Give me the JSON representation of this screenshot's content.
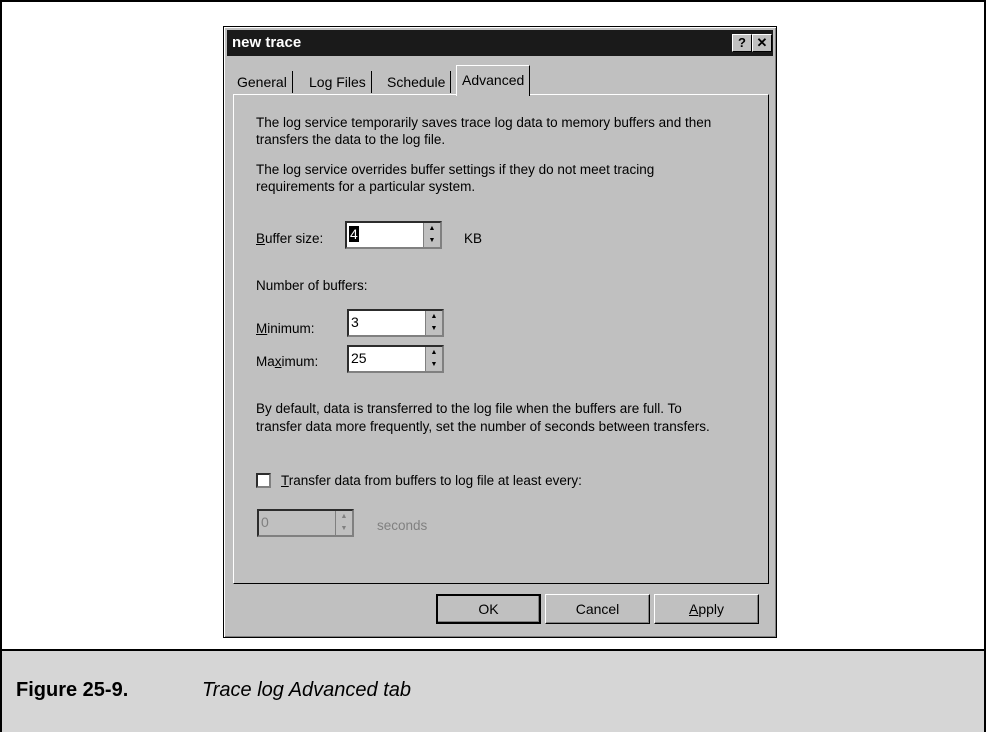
{
  "dialog": {
    "title": "new trace",
    "help_icon": "?",
    "close_icon": "✕"
  },
  "tabs": [
    {
      "label": "General"
    },
    {
      "label": "Log Files"
    },
    {
      "label": "Schedule"
    },
    {
      "label": "Advanced",
      "active": true
    }
  ],
  "advanced": {
    "intro1_line1": "The log service temporarily saves trace log data to memory buffers and then",
    "intro1_line2": "transfers the data to the log file.",
    "intro2_line1": "The log service overrides buffer settings if they do not meet tracing",
    "intro2_line2": "requirements for a particular system.",
    "buffer_size_label_mnemonic": "B",
    "buffer_size_label_rest": "uffer size:",
    "buffer_size_value": "4",
    "buffer_size_unit": "KB",
    "num_buffers_label": "Number of buffers:",
    "minimum_label_mnemonic": "M",
    "minimum_label_rest": "inimum:",
    "minimum_value": "3",
    "maximum_label_pre": "Ma",
    "maximum_label_mnemonic": "x",
    "maximum_label_rest": "imum:",
    "maximum_value": "25",
    "default_note_line1": "By default, data is transferred to the log file when the buffers are full. To",
    "default_note_line2": "transfer data more frequently, set the number of seconds between transfers.",
    "transfer_checkbox_mnemonic": "T",
    "transfer_checkbox_rest": "ransfer data from buffers to log file at least every:",
    "transfer_checked": false,
    "seconds_value": "0",
    "seconds_unit": "seconds"
  },
  "buttons": {
    "ok": "OK",
    "cancel": "Cancel",
    "apply_mnemonic": "A",
    "apply_rest": "pply"
  },
  "caption": {
    "number": "Figure 25-9.",
    "text": "Trace log Advanced tab"
  }
}
